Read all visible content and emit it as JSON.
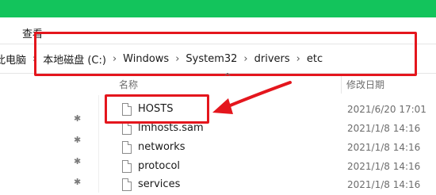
{
  "menu": {
    "view_label": "查看"
  },
  "address": {
    "crumbs": [
      "此电脑",
      "本地磁盘 (C:)",
      "Windows",
      "System32",
      "drivers",
      "etc"
    ],
    "separator": "›"
  },
  "columns": {
    "name": "名称",
    "date": "修改日期",
    "sort_indicator": "^"
  },
  "files": [
    {
      "name": "HOSTS",
      "modified": "2021/6/20 17:01",
      "icon": "document-icon"
    },
    {
      "name": "lmhosts.sam",
      "modified": "2021/1/8 14:16",
      "icon": "document-icon"
    },
    {
      "name": "networks",
      "modified": "2021/1/8 14:16",
      "icon": "document-icon"
    },
    {
      "name": "protocol",
      "modified": "2021/1/8 14:16",
      "icon": "document-icon"
    },
    {
      "name": "services",
      "modified": "2021/1/8 14:16",
      "icon": "document-icon"
    }
  ],
  "quick_access": {
    "pin_icon": "pin-icon",
    "pin_glyph": "✱"
  },
  "annotations": {
    "highlight_color": "#e4161d",
    "arrow_icon": "arrow-icon"
  },
  "colors": {
    "title_bar": "#13c45c"
  }
}
